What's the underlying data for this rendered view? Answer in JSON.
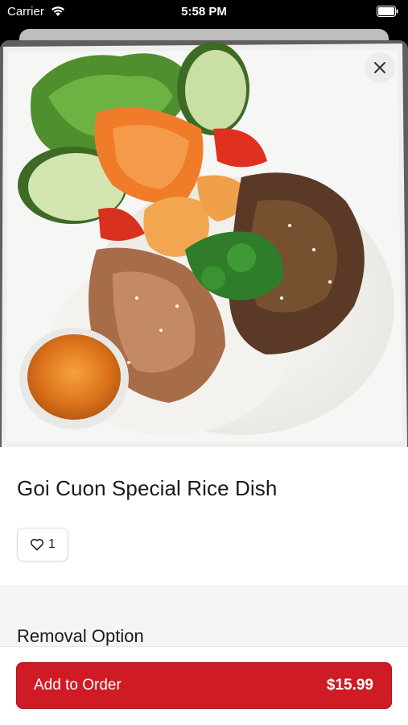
{
  "status_bar": {
    "carrier": "Carrier",
    "time": "5:58 PM"
  },
  "dish": {
    "title": "Goi Cuon Special Rice Dish",
    "like_count": "1",
    "photo_icon": "dish-photo"
  },
  "options": {
    "heading": "Removal Option"
  },
  "order_button": {
    "label": "Add to Order",
    "price": "$15.99"
  },
  "colors": {
    "accent": "#cf1b24",
    "status_bar_bg": "#000000",
    "section_bg": "#f5f5f5"
  },
  "icons": [
    "wifi-icon",
    "battery-icon",
    "close-icon",
    "heart-icon"
  ]
}
